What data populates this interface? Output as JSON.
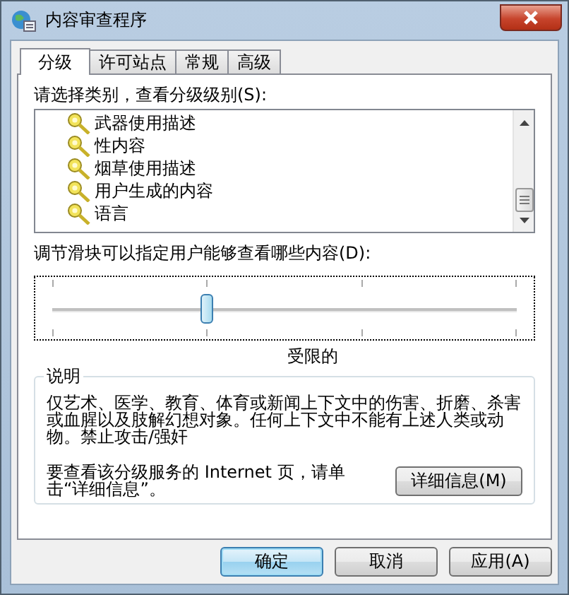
{
  "window": {
    "title": "内容审查程序"
  },
  "tabs": [
    {
      "label": "分级",
      "selected": true
    },
    {
      "label": "许可站点",
      "selected": false
    },
    {
      "label": "常规",
      "selected": false
    },
    {
      "label": "高级",
      "selected": false
    }
  ],
  "category_label": "请选择类别，查看分级级别(S):",
  "categories": [
    {
      "label": "武器使用描述"
    },
    {
      "label": "性内容"
    },
    {
      "label": "烟草使用描述"
    },
    {
      "label": "用户生成的内容"
    },
    {
      "label": "语言"
    }
  ],
  "slider": {
    "label": "调节滑块可以指定用户能够查看哪些内容(D):",
    "level": 0.333,
    "reading": "受限的"
  },
  "description": {
    "title": "说明",
    "text": "仅艺术、医学、教育、体育或新闻上下文中的伤害、折磨、杀害或血腥以及肢解幻想对象。任何上下文中不能有上述人类或动物。禁止攻击/强奸",
    "link_text": "要查看该分级服务的 Internet 页，请单击“详细信息”。",
    "button": "详细信息(M)"
  },
  "buttons": [
    {
      "label": "确定",
      "default": true
    },
    {
      "label": "取消",
      "default": false
    },
    {
      "label": "应用(A)",
      "default": false
    }
  ]
}
